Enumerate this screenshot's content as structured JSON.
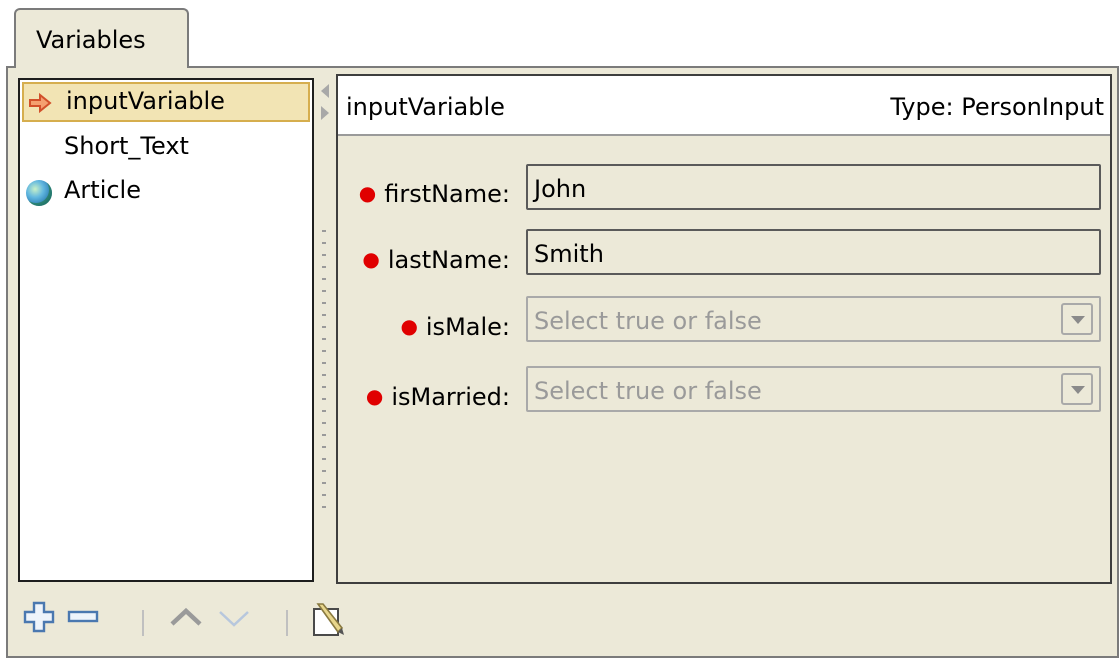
{
  "tab": {
    "label": "Variables"
  },
  "tree": {
    "items": [
      {
        "label": "inputVariable",
        "icon": "arrow-right-icon",
        "selected": true
      },
      {
        "label": "Short_Text",
        "icon": "",
        "selected": false
      },
      {
        "label": "Article",
        "icon": "globe-icon",
        "selected": false
      }
    ]
  },
  "detail": {
    "name": "inputVariable",
    "type_label": "Type: PersonInput",
    "fields": [
      {
        "label": "firstName:",
        "value": "John",
        "kind": "text"
      },
      {
        "label": "lastName:",
        "value": "Smith",
        "kind": "text"
      },
      {
        "label": "isMale:",
        "placeholder": "Select true or false",
        "kind": "select"
      },
      {
        "label": "isMarried:",
        "placeholder": "Select true or false",
        "kind": "select"
      }
    ]
  },
  "toolbar": {
    "icons": [
      "add-icon",
      "remove-icon",
      "move-up-icon",
      "move-down-icon",
      "edit-icon"
    ]
  },
  "colors": {
    "panel_bg": "#ece9d8",
    "selection_bg": "#f2e4b4",
    "required_dot": "#e00000",
    "add_icon": "#4a78b0"
  }
}
